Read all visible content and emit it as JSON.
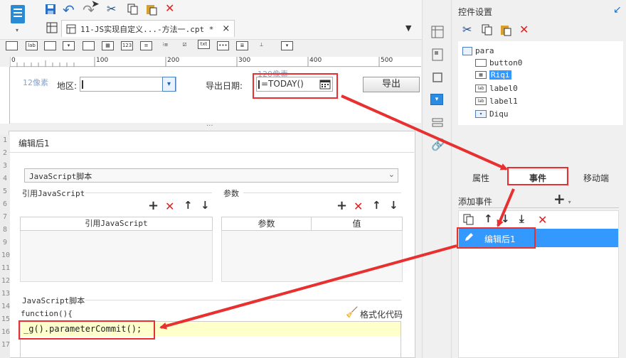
{
  "toolbar": {
    "tab_title": "11-JS实现自定义...-方法一.cpt *",
    "tab_close": "×",
    "widget_labels": [
      "lab",
      "txt"
    ]
  },
  "ruler": {
    "ticks": [
      "0",
      "100",
      "200",
      "300",
      "400",
      "500"
    ]
  },
  "design": {
    "px_label": "12像素",
    "region_label": "地区:",
    "export_date_label": "导出日期:",
    "date_formula": "=TODAY()",
    "px_label_top": "120像素",
    "export_button": "导出",
    "splitter": "···"
  },
  "dialog": {
    "title": "编辑后1",
    "script_type": "JavaScript脚本",
    "ref_js_label": "引用JavaScript",
    "params_label": "参数",
    "col_ref_js": "引用JavaScript",
    "col_param": "参数",
    "col_value": "值",
    "script_section_label": "JavaScript脚本",
    "code_header": "function(){",
    "format_code": "格式化代码",
    "code_line": "_g().parameterCommit();",
    "line_numbers": [
      "1",
      "2",
      "3",
      "4",
      "5",
      "6",
      "7",
      "8",
      "9",
      "10",
      "11",
      "12",
      "13",
      "14",
      "15",
      "16",
      "17"
    ]
  },
  "right_panel": {
    "title": "控件设置",
    "tree": [
      {
        "label": "para",
        "icon": "form"
      },
      {
        "label": "button0",
        "icon": "button"
      },
      {
        "label": "Riqi",
        "icon": "date",
        "selected": true
      },
      {
        "label": "label0",
        "icon": "lab"
      },
      {
        "label": "label1",
        "icon": "lab"
      },
      {
        "label": "Diqu",
        "icon": "combo"
      }
    ],
    "tabs": [
      "属性",
      "事件",
      "移动端"
    ],
    "active_tab": "事件",
    "add_event_label": "添加事件",
    "add_plus": "+",
    "event_item": "编辑后1"
  },
  "colors": {
    "selection": "#3399ff",
    "accent": "#1e74c6",
    "highlight_code": "#ffffcc",
    "annotation": "#e83030"
  }
}
